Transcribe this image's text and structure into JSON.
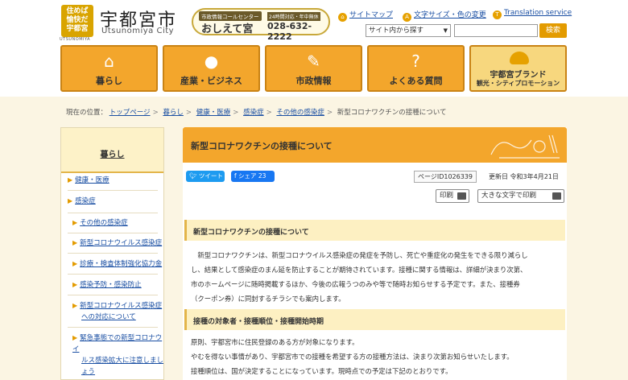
{
  "header": {
    "logo_text": [
      "住めば",
      "愉快だ",
      "宇都宮"
    ],
    "logo_sub": "UTSUNOMIYA",
    "city_name": "宇都宮市",
    "city_roman": "Utsunomiya City",
    "callcenter": {
      "small": "市政情報コールセンター",
      "big": "おしえて宮",
      "hours": "24時間対応・年中無休",
      "tel": "028-632-2222"
    },
    "links": {
      "sitemap": "サイトマップ",
      "fontsize": "文字サイズ・色の変更",
      "translation": "Translation service"
    },
    "search": {
      "select": "サイト内から探す",
      "button": "検索"
    }
  },
  "gnav": {
    "items": [
      {
        "label": "暮らし",
        "icon": "home-icon"
      },
      {
        "label": "産業・ビジネス",
        "icon": "person-icon"
      },
      {
        "label": "市政情報",
        "icon": "pen-icon"
      },
      {
        "label": "よくある質問",
        "icon": "question-icon"
      }
    ],
    "brand": {
      "title": "宇都宮ブランド",
      "sub": "観光・シティプロモーション"
    }
  },
  "breadcrumb": {
    "prefix": "現在の位置：",
    "items": [
      "トップページ",
      "暮らし",
      "健康・医療",
      "感染症",
      "その他の感染症"
    ],
    "current": "新型コロナワクチンの接種について"
  },
  "sidebar": {
    "title": "暮らし",
    "items": [
      {
        "label": "健康・医療"
      },
      {
        "label": "感染症"
      },
      {
        "label": "その他の感染症"
      },
      {
        "label": "新型コロナウイルス感染症"
      },
      {
        "label": "診療・検査体制強化協力金"
      },
      {
        "label": "感染予防・感染防止"
      },
      {
        "label": "新型コロナウイルス感染症",
        "label2": "への対応について"
      },
      {
        "label": "緊急事態での新型コロナウイ",
        "label2": "ルス感染拡大に注意しまし",
        "label3": "ょう"
      }
    ]
  },
  "content": {
    "title": "新型コロナワクチンの接種について",
    "tweet": "ツイート",
    "share": "シェア 23",
    "page_id": "ページID1026339",
    "updated": "更新日 令和3年4月21日",
    "print": "印刷",
    "large_print": "大きな文字で印刷",
    "section1": {
      "heading": "新型コロナワクチンの接種について",
      "lines": [
        "　新型コロナワクチンは、新型コロナウイルス感染症の発症を予防し、死亡や重症化の発生をできる限り減らし",
        "し、結果として感染症のまん延を防止することが期待されています。接種に関する情報は、詳細が決まり次第、",
        "市のホームページに随時掲載するほか、今後の広報うつのみや等で随時お知らせする予定です。また、接種券",
        "（クーポン券）に同封するチラシでも案内します。"
      ]
    },
    "section2": {
      "heading": "接種の対象者・接種順位・接種開始時期",
      "lines": [
        "原則、宇都宮市に住民登録のある方が対象になります。",
        "やむを得ない事情があり、宇都宮市での接種を希望する方の接種方法は、決まり次第お知らせいたします。",
        "接種順位は、国が決定することになっています。現時点での予定は下記のとおりです。"
      ]
    }
  },
  "colors": {
    "accent": "#f3a62c",
    "link": "#1a4fa3",
    "background": "#fbf5e3",
    "section_bg": "#fdf0c2"
  }
}
